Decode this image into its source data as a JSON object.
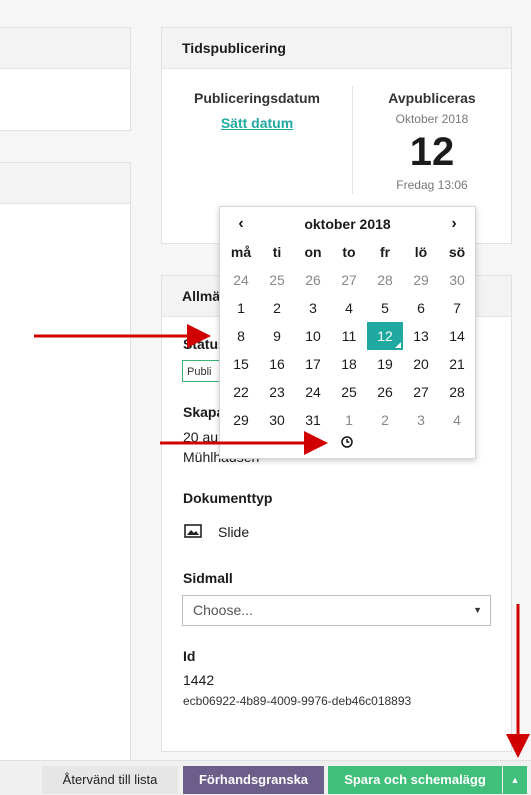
{
  "tidspublicering": {
    "title": "Tidspublicering",
    "publish_label": "Publiceringsdatum",
    "set_date": "Sätt datum",
    "unpublish_label": "Avpubliceras",
    "unpublish_month": "Oktober 2018",
    "unpublish_day": "12",
    "unpublish_time": "Fredag 13:06"
  },
  "allmant": {
    "title": "Allmänt",
    "status_label": "Status",
    "status_value": "Publi",
    "created_label": "Skapad",
    "created_value": "20 au",
    "created_by": "Mühlhausen",
    "doctype_label": "Dokumenttyp",
    "doctype_value": "Slide",
    "template_label": "Sidmall",
    "template_placeholder": "Choose...",
    "id_label": "Id",
    "id_value": "1442",
    "guid": "ecb06922-4b89-4009-9976-deb46c018893"
  },
  "calendar": {
    "month_label": "oktober 2018",
    "prev": "‹",
    "next": "›",
    "weekdays": [
      "må",
      "ti",
      "on",
      "to",
      "fr",
      "lö",
      "sö"
    ],
    "weeks": [
      [
        "24",
        "25",
        "26",
        "27",
        "28",
        "29",
        "30"
      ],
      [
        "1",
        "2",
        "3",
        "4",
        "5",
        "6",
        "7"
      ],
      [
        "8",
        "9",
        "10",
        "11",
        "12",
        "13",
        "14"
      ],
      [
        "15",
        "16",
        "17",
        "18",
        "19",
        "20",
        "21"
      ],
      [
        "22",
        "23",
        "24",
        "25",
        "26",
        "27",
        "28"
      ],
      [
        "29",
        "30",
        "31",
        "1",
        "2",
        "3",
        "4"
      ]
    ],
    "selected": "12"
  },
  "footer": {
    "back": "Återvänd till lista",
    "preview": "Förhandsgranska",
    "save": "Spara och schemalägg",
    "dropdown": "▲"
  },
  "colors": {
    "accent": "#1fa9a1",
    "preview_button": "#6b5e8a",
    "save_button": "#3fbf7a",
    "annotation_arrow": "#d00000"
  }
}
